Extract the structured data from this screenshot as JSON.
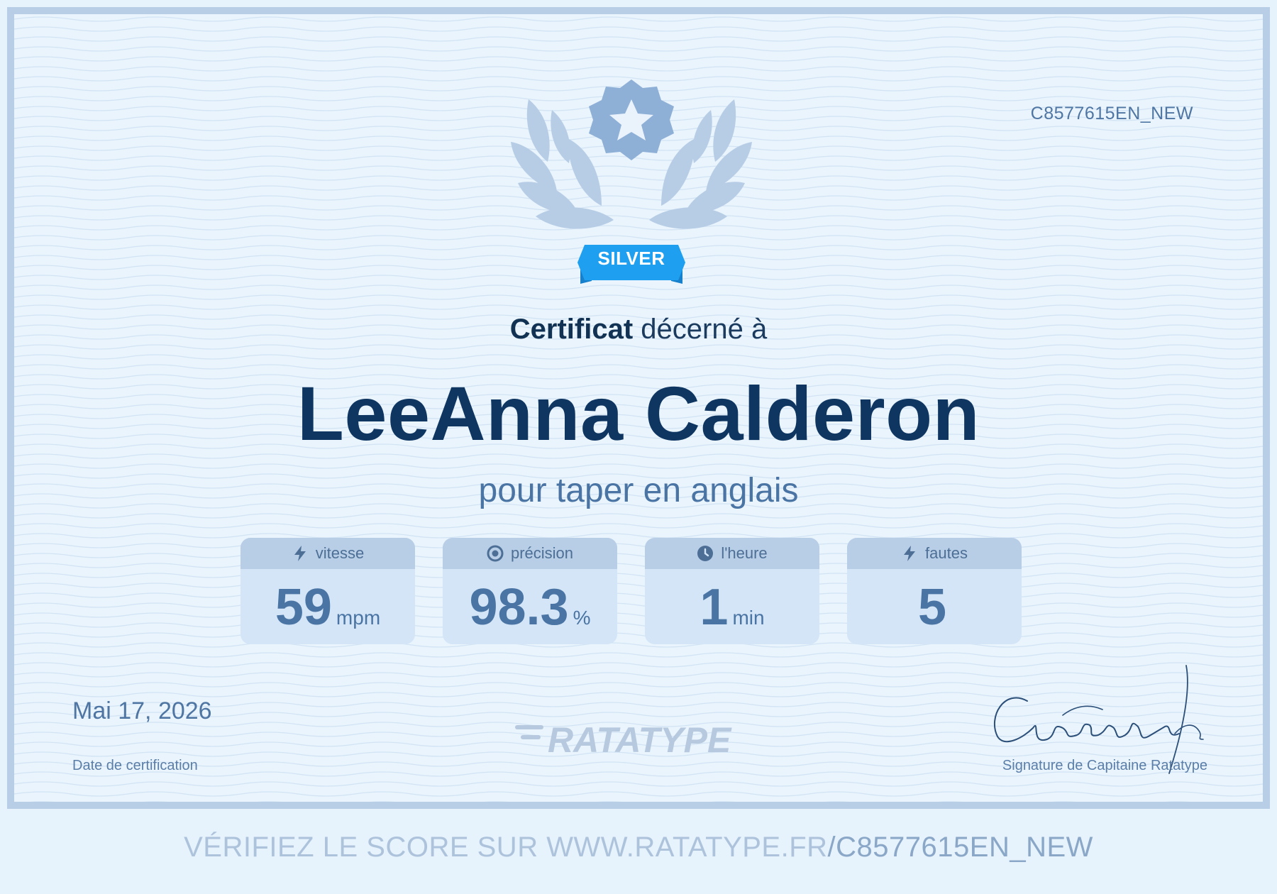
{
  "certificate": {
    "id": "C8577615EN_NEW",
    "badge_label": "SILVER",
    "awarded_bold": "Certificat",
    "awarded_rest": "décerné à",
    "recipient": "LeeAnna Calderon",
    "purpose": "pour taper en anglais",
    "stats": [
      {
        "label": "vitesse",
        "icon": "bolt-icon",
        "value": "59",
        "unit": "mpm"
      },
      {
        "label": "précision",
        "icon": "target-icon",
        "value": "98.3",
        "unit": "%"
      },
      {
        "label": "l'heure",
        "icon": "clock-icon",
        "value": "1",
        "unit": "min"
      },
      {
        "label": "fautes",
        "icon": "bolt-icon",
        "value": "5",
        "unit": ""
      }
    ],
    "date": "Mai 17, 2026",
    "date_label": "Date de certification",
    "logo_text": "RATATYPE",
    "signature_label": "Signature de Capitaine Ratatype"
  },
  "footer": {
    "verify_text": "VÉRIFIEZ LE SCORE SUR WWW.RATATYPE.FR",
    "verify_code": "/C8577615EN_NEW"
  },
  "colors": {
    "border": "#b8cde6",
    "badge_ribbon": "#1e9ff0",
    "title": "#0f3561",
    "accent": "#4a74a3"
  }
}
